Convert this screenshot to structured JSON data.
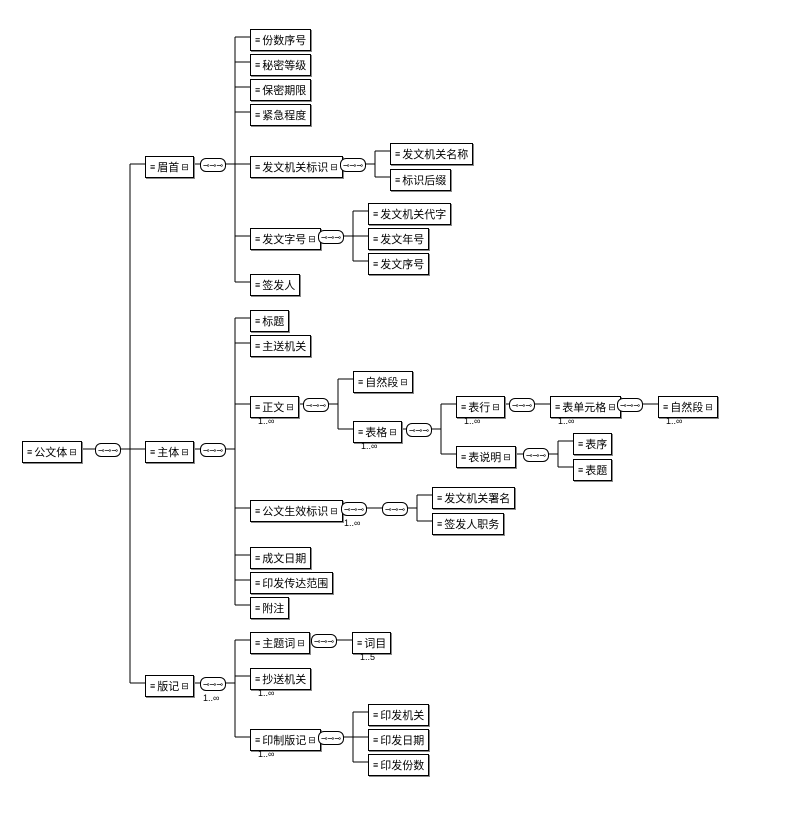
{
  "root": "公文体",
  "level1": {
    "meishou": "眉首",
    "zhuti": "主体",
    "banji": "版记"
  },
  "meishou_children": {
    "fenshu": "份数序号",
    "miji": "秘密等级",
    "baomi": "保密期限",
    "jinji": "紧急程度",
    "fawen_biaoshi": "发文机关标识",
    "fawen_zihao": "发文字号",
    "qianfaren": "签发人"
  },
  "fawen_biaoshi_children": {
    "mingcheng": "发文机关名称",
    "houzhui": "标识后缀"
  },
  "fawen_zihao_children": {
    "daizi": "发文机关代字",
    "nianhao": "发文年号",
    "xuhao": "发文序号"
  },
  "zhuti_children": {
    "biaoti": "标题",
    "zhusong": "主送机关",
    "zhengwen": "正文",
    "shengxiao": "公文生效标识",
    "chengwen": "成文日期",
    "yinfa_fanwei": "印发传达范围",
    "fuzhu": "附注"
  },
  "zhengwen_children": {
    "ziranduan": "自然段",
    "biaoge": "表格"
  },
  "biaoge_children": {
    "biaohang": "表行",
    "biaoshuoming": "表说明"
  },
  "biaohang_children": {
    "danyuange": "表单元格",
    "ziranduan2": "自然段"
  },
  "biaoshuoming_children": {
    "biaoxu": "表序",
    "biaoti2": "表题"
  },
  "shengxiao_children": {
    "shuming": "发文机关署名",
    "zhiwu": "签发人职务"
  },
  "banji_children": {
    "zhuticizu": "主题词",
    "chaosong": "抄送机关",
    "yinzhi": "印制版记"
  },
  "zhuticizu_children": {
    "cimu": "词目"
  },
  "yinzhi_children": {
    "jiguan": "印发机关",
    "riqi": "印发日期",
    "fenshu": "印发份数"
  },
  "cardinality": {
    "one_inf": "1..∞",
    "one_five": "1..5"
  },
  "conn_symbol": "⊸⊸⊸"
}
